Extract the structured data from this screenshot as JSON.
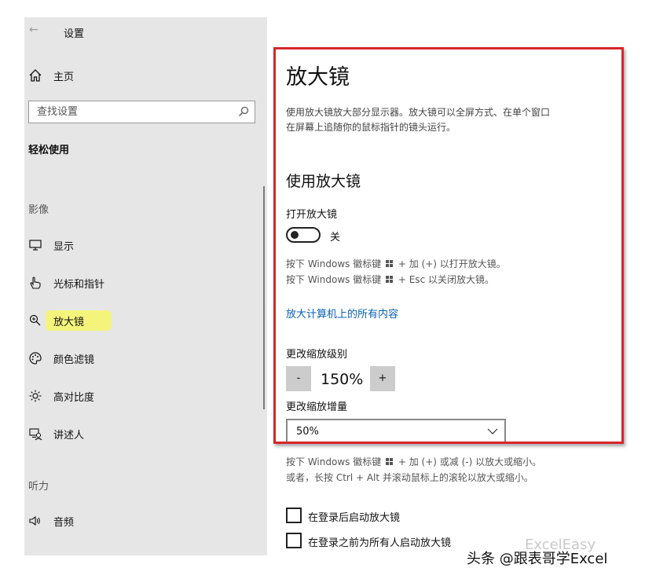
{
  "window": {
    "title": "设置",
    "back_icon": "arrow-left-icon"
  },
  "sidebar": {
    "home_label": "主页",
    "search_placeholder": "查找设置",
    "section_title": "轻松使用",
    "groups": [
      {
        "label": "影像",
        "items": [
          {
            "label": "显示",
            "icon": "monitor-icon"
          },
          {
            "label": "光标和指针",
            "icon": "pointer-hand-icon"
          },
          {
            "label": "放大镜",
            "icon": "magnifier-icon",
            "active": true
          },
          {
            "label": "颜色滤镜",
            "icon": "palette-icon"
          },
          {
            "label": "高对比度",
            "icon": "sun-contrast-icon"
          },
          {
            "label": "讲述人",
            "icon": "narrator-icon"
          }
        ]
      },
      {
        "label": "听力",
        "items": [
          {
            "label": "音频",
            "icon": "speaker-icon"
          }
        ]
      }
    ],
    "highlight_color": "#f6f66a"
  },
  "main": {
    "title": "放大镜",
    "description_line1": "使用放大镜放大部分显示器。放大镜可以全屏方式、在单个窗口",
    "description_line2": "在屏幕上追随你的鼠标指针的镜头运行。",
    "section_heading": "使用放大镜",
    "toggle_label": "打开放大镜",
    "toggle_state": "关",
    "toggle_on": false,
    "hint_open_pre": "按下 Windows 徽标键",
    "hint_open_post": "+ 加 (+) 以打开放大镜。",
    "hint_close_pre": "按下 Windows 徽标键",
    "hint_close_post": "+ Esc 以关闭放大镜。",
    "link_text": "放大计算机上的所有内容",
    "zoom_level_label": "更改缩放级别",
    "zoom_minus": "-",
    "zoom_value": "150%",
    "zoom_plus": "+",
    "zoom_increment_label": "更改缩放增量",
    "zoom_increment_value": "50%",
    "zoom_hint1_pre": "按下 Windows 徽标键",
    "zoom_hint1_post": "+ 加 (+) 或减 (-) 以放大或缩小。",
    "zoom_hint2": "或者，长按 Ctrl + Alt 并滚动鼠标上的滚轮以放大或缩小。",
    "checkbox1_label": "在登录后启动放大镜",
    "checkbox2_label": "在登录之前为所有人启动放大镜",
    "link_color": "#0a62b8",
    "frame_color": "#d8262a"
  },
  "watermark": {
    "text": "头条 @跟表哥学Excel",
    "bg_text": "ExcelEasy"
  }
}
